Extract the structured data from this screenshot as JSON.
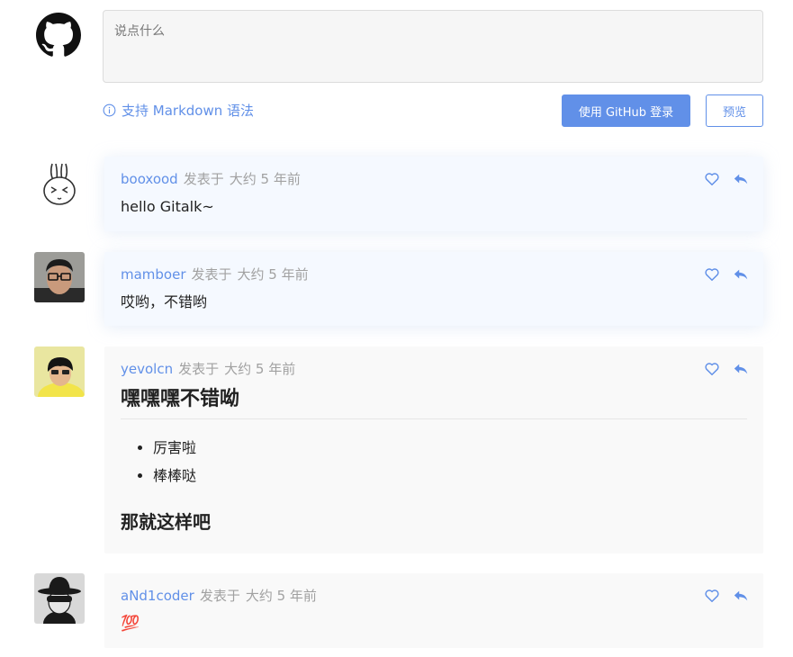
{
  "editor": {
    "placeholder": "说点什么",
    "markdown_tip": "支持 Markdown 语法",
    "login_label": "使用 GitHub 登录",
    "preview_label": "预览"
  },
  "colors": {
    "accent": "#6190e8",
    "meta": "#a1a1a1"
  },
  "comments": [
    {
      "author": "booxood",
      "posted_label": "发表于",
      "time": "大约 5 年前",
      "body": "hello Gitalk~",
      "avatar_icon": "rabbit-avatar"
    },
    {
      "author": "mamboer",
      "posted_label": "发表于",
      "time": "大约 5 年前",
      "body": "哎哟，不错哟",
      "avatar_icon": "person-glasses-avatar"
    },
    {
      "author": "yevolcn",
      "posted_label": "发表于",
      "time": "大约 5 年前",
      "heading": "嘿嘿嘿不错呦",
      "list": [
        "厉害啦",
        "棒棒哒"
      ],
      "subheading": "那就这样吧",
      "avatar_icon": "person-yellow-avatar"
    },
    {
      "author": "aNd1coder",
      "posted_label": "发表于",
      "time": "大约 5 年前",
      "body": "💯",
      "avatar_icon": "hat-person-avatar"
    }
  ]
}
